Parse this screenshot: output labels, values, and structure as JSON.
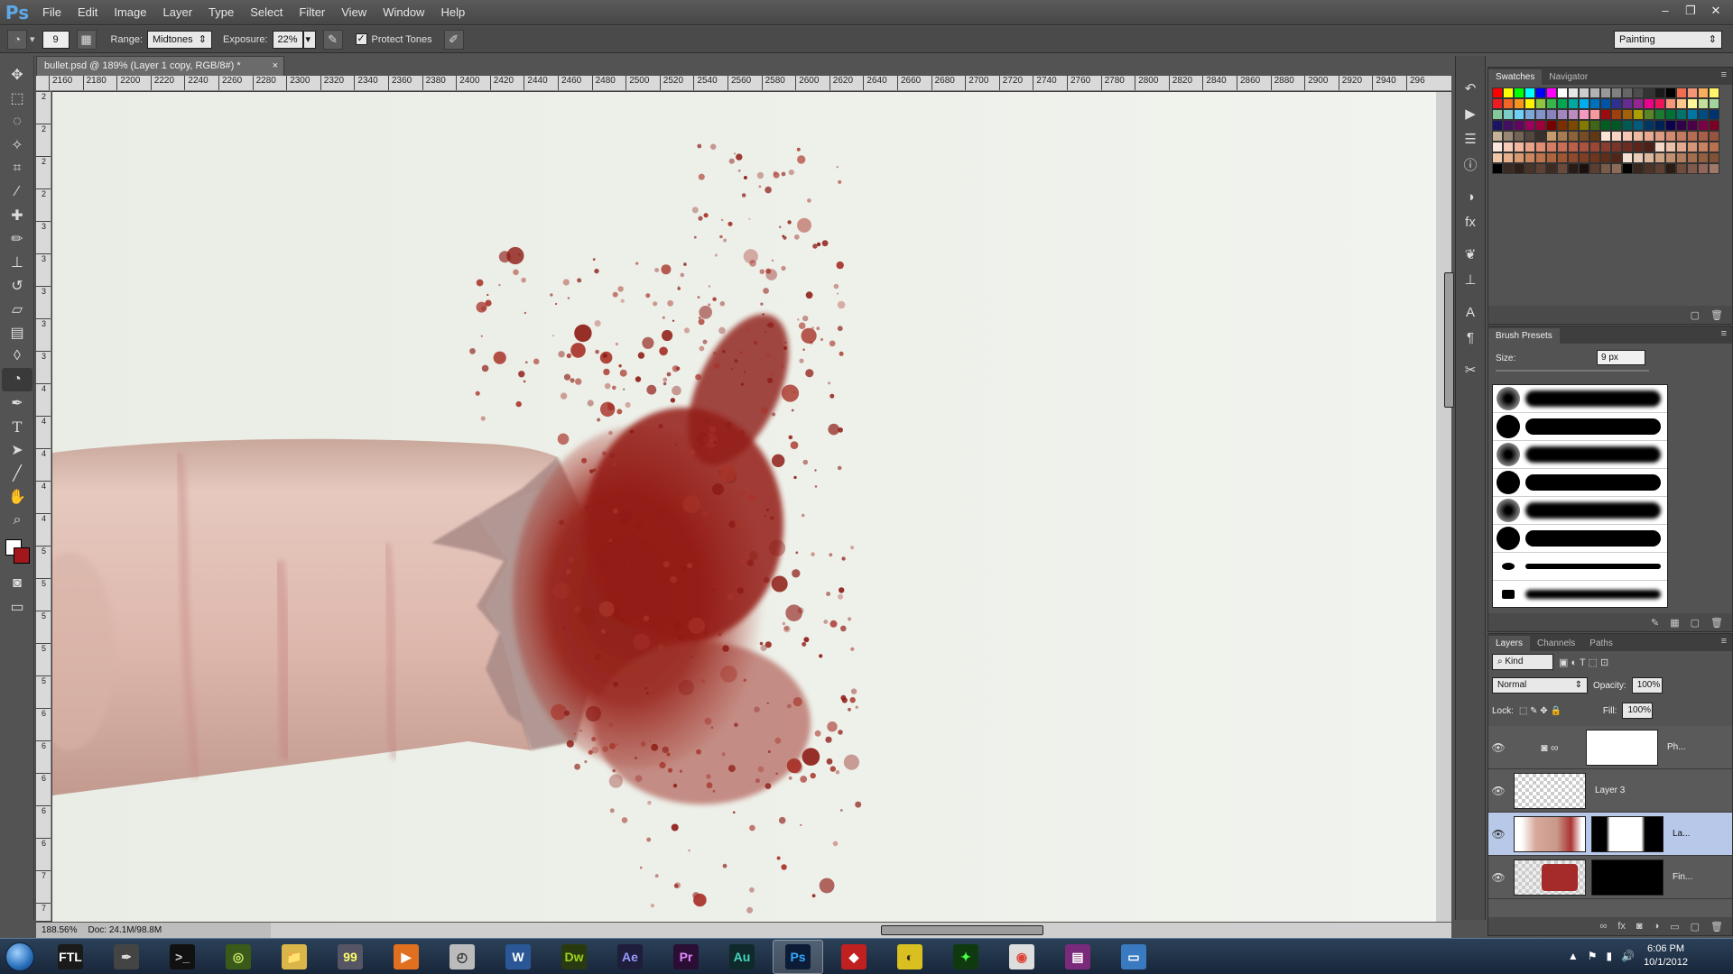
{
  "app": {
    "logo": "Ps"
  },
  "menu": [
    "File",
    "Edit",
    "Image",
    "Layer",
    "Type",
    "Select",
    "Filter",
    "View",
    "Window",
    "Help"
  ],
  "window_controls": {
    "minimize": "–",
    "restore": "❐",
    "close": "✕"
  },
  "options": {
    "brush_size": "9",
    "range_label": "Range:",
    "range_value": "Midtones",
    "exposure_label": "Exposure:",
    "exposure_value": "22%",
    "protect_tones_label": "Protect Tones",
    "protect_tones_checked": true,
    "workspace": "Painting"
  },
  "document": {
    "tab_title": "bullet.psd @ 189% (Layer 1 copy, RGB/8#) *",
    "close": "×",
    "zoom": "188.56%",
    "doc_info": "Doc: 24.1M/98.8M"
  },
  "ruler_h": [
    "2160",
    "2180",
    "2200",
    "2220",
    "2240",
    "2260",
    "2280",
    "2300",
    "2320",
    "2340",
    "2360",
    "2380",
    "2400",
    "2420",
    "2440",
    "2460",
    "2480",
    "2500",
    "2520",
    "2540",
    "2560",
    "2580",
    "2600",
    "2620",
    "2640",
    "2660",
    "2680",
    "2700",
    "2720",
    "2740",
    "2760",
    "2780",
    "2800",
    "2820",
    "2840",
    "2860",
    "2880",
    "2900",
    "2920",
    "2940",
    "296"
  ],
  "ruler_v": [
    "2",
    "2",
    "2",
    "2",
    "3",
    "3",
    "3",
    "3",
    "3",
    "4",
    "4",
    "4",
    "4",
    "4",
    "5",
    "5",
    "5",
    "5",
    "5",
    "6",
    "6",
    "6",
    "6",
    "6",
    "7",
    "7"
  ],
  "panels": {
    "swatches": {
      "tabs": [
        "Swatches",
        "Navigator"
      ]
    },
    "brush_presets": {
      "tab": "Brush Presets",
      "size_label": "Size:",
      "size_value": "9 px"
    },
    "layers": {
      "tabs": [
        "Layers",
        "Channels",
        "Paths"
      ],
      "kind": "Kind",
      "blend_mode": "Normal",
      "opacity_label": "Opacity:",
      "opacity_value": "100%",
      "lock_label": "Lock:",
      "fill_label": "Fill:",
      "fill_value": "100%",
      "rows": [
        {
          "name": "Ph..."
        },
        {
          "name": "Layer 3"
        },
        {
          "name": "La..."
        },
        {
          "name": "Fin..."
        }
      ]
    }
  },
  "taskbar": {
    "apps": [
      {
        "name": "FTL",
        "color": "#1a1a1a",
        "text": "#fff"
      },
      {
        "name": "✒",
        "color": "#444",
        "text": "#ddd"
      },
      {
        "name": ">_",
        "color": "#111",
        "text": "#ccc"
      },
      {
        "name": "◎",
        "color": "#3a5a1a",
        "text": "#cde86a"
      },
      {
        "name": "📁",
        "color": "#d9b54a",
        "text": "#333"
      },
      {
        "name": "99",
        "color": "#556",
        "text": "#ff6"
      },
      {
        "name": "▶",
        "color": "#e07020",
        "text": "#fff"
      },
      {
        "name": "◴",
        "color": "#bbb",
        "text": "#333"
      },
      {
        "name": "W",
        "color": "#2b5797",
        "text": "#fff"
      },
      {
        "name": "Dw",
        "color": "#2a3a10",
        "text": "#9bd51d"
      },
      {
        "name": "Ae",
        "color": "#1e1e3c",
        "text": "#9999ff"
      },
      {
        "name": "Pr",
        "color": "#2a0e34",
        "text": "#e08aff"
      },
      {
        "name": "Au",
        "color": "#0f2a2a",
        "text": "#44d6c0"
      },
      {
        "name": "Ps",
        "color": "#0d1c36",
        "text": "#31a8ff",
        "active": true
      },
      {
        "name": "◆",
        "color": "#c02020",
        "text": "#fff"
      },
      {
        "name": "◐",
        "color": "#d9c020",
        "text": "#222"
      },
      {
        "name": "✦",
        "color": "#0f3a0f",
        "text": "#44ff44"
      },
      {
        "name": "◉",
        "color": "#dddddd",
        "text": "#db4437"
      },
      {
        "name": "▤",
        "color": "#7a2a7a",
        "text": "#fff"
      },
      {
        "name": "▭",
        "color": "#3a7ac0",
        "text": "#fff"
      }
    ],
    "time": "6:06 PM",
    "date": "10/1/2012"
  }
}
